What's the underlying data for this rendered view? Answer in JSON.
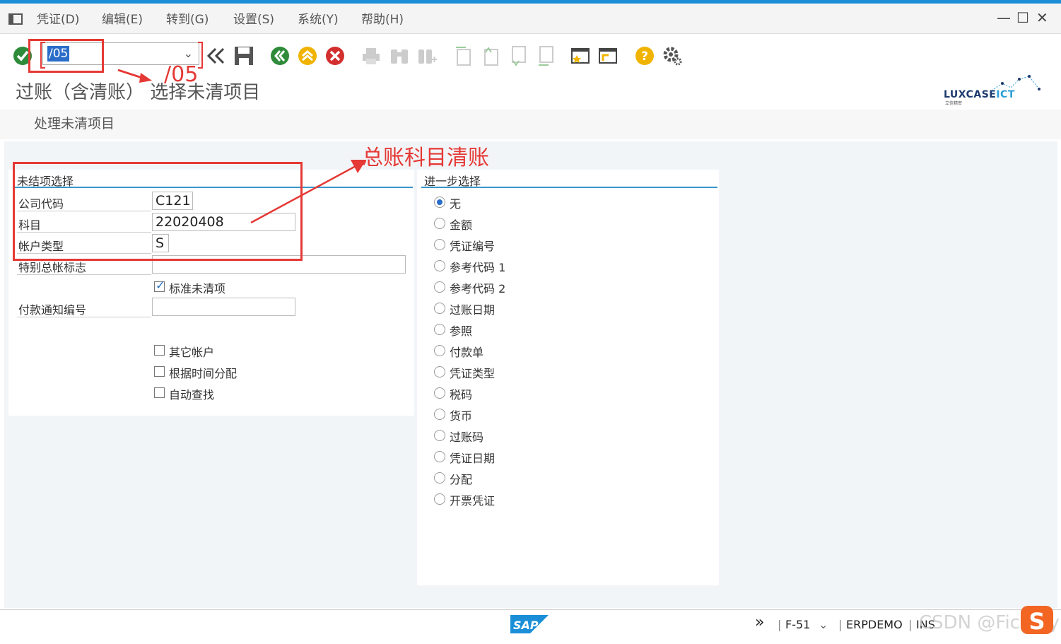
{
  "menubar": {
    "items": [
      "凭证(D)",
      "编辑(E)",
      "转到(G)",
      "设置(S)",
      "系统(Y)",
      "帮助(H)"
    ]
  },
  "toolbar": {
    "command_value": "/05"
  },
  "page": {
    "title": "过账（含清账） 选择未清项目",
    "app_button": "处理未清项目"
  },
  "logo": {
    "text_main": "LUXCASE",
    "text_accent": "ICT",
    "sub": "立信精密"
  },
  "open_item_selection": {
    "title": "未结项选择",
    "company_code_label": "公司代码",
    "company_code_value": "C121",
    "account_label": "科目",
    "account_value": "22020408",
    "account_type_label": "帐户类型",
    "account_type_value": "S",
    "special_gl_label": "特别总帐标志",
    "standard_oi_label": "标准未清项",
    "payment_advice_label": "付款通知编号",
    "other_accounts_label": "其它帐户",
    "distribute_by_age_label": "根据时间分配",
    "auto_search_label": "自动查找"
  },
  "further_selection": {
    "title": "进一步选择",
    "options": [
      "无",
      "金额",
      "凭证编号",
      "参考代码 1",
      "参考代码 2",
      "过账日期",
      "参照",
      "付款单",
      "凭证类型",
      "税码",
      "货币",
      "过账码",
      "凭证日期",
      "分配",
      "开票凭证"
    ]
  },
  "statusbar": {
    "sap_logo": "SAP",
    "tcode": "F-51",
    "system": "ERPDEMO",
    "mode": "INS"
  },
  "annotations": {
    "cmd_arrow_text": "/05",
    "gl_clearing_text": "总账科目清账"
  },
  "watermark": "CSDN @Fico fly"
}
